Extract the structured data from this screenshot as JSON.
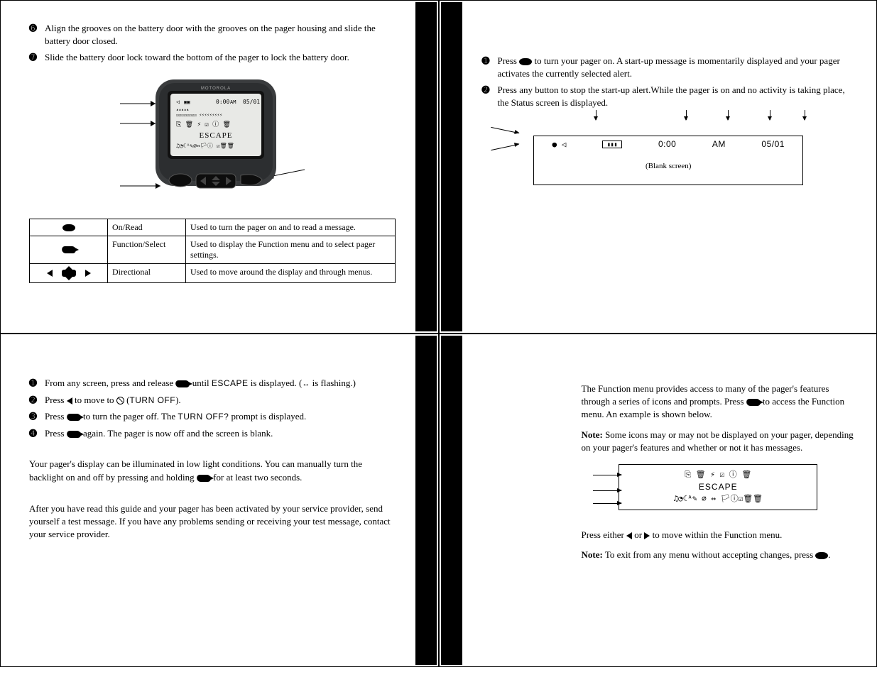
{
  "tl": {
    "steps": [
      {
        "num": "➏",
        "text": "Align the grooves on the battery door with the grooves on the pager housing and slide the battery door closed."
      },
      {
        "num": "➐",
        "text": "Slide the battery door lock toward the bottom of the pager to lock the battery door."
      }
    ],
    "device": {
      "brand": "MOTOROLA",
      "line1_time": "0:00",
      "line1_ampm": "AM",
      "line1_date": "05/01",
      "line3_escape": "ESCAPE"
    },
    "table": {
      "rows": [
        {
          "icon": "oval",
          "name": "On/Read",
          "desc": "Used to turn the pager on and to read a message."
        },
        {
          "icon": "fs",
          "name": "Function/Select",
          "desc": "Used to display the Function menu and to select pager settings."
        },
        {
          "icon": "dir",
          "name": "Directional",
          "desc": "Used to move around the display and through menus."
        }
      ]
    }
  },
  "tr": {
    "steps": [
      {
        "num": "➊",
        "pre": "Press ",
        "post": " to turn your pager on. A start-up message is momentarily displayed and your pager activates the currently selected alert."
      },
      {
        "num": "➋",
        "text": "Press any button to stop the start-up alert.While the pager is on and no activity is taking place, the Status screen is displayed."
      }
    ],
    "status": {
      "time": "0:00",
      "ampm": "AM",
      "date": "05/01",
      "blank": "(Blank screen)"
    }
  },
  "bl": {
    "steps": [
      {
        "num": "➊",
        "pre": "From any screen, press and release ",
        "mid": " until ",
        "word1": "ESCAPE",
        "post1": " is displayed. (",
        "post2": " is flashing.)"
      },
      {
        "num": "➋",
        "pre": "Press ",
        "mid": " to move to ",
        "word1": " (",
        "word2": "TURN OFF",
        "post": ")."
      },
      {
        "num": "➌",
        "pre": "Press ",
        "mid": " to turn the pager off. The ",
        "word1": "TURN OFF?",
        "post": " prompt is displayed."
      },
      {
        "num": "➍",
        "pre": "Press ",
        "post": " again. The pager is now off and the screen is blank."
      }
    ],
    "para_backlight": "Your pager's display can be illuminated in low light conditions. You can manually turn the backlight on and off by pressing and holding ",
    "para_backlight_end": " for at least two seconds.",
    "para_test": "After you have read this guide and your pager has been activated by your service provider, send yourself a test message. If you have any problems sending or receiving your test message, contact your service provider."
  },
  "br": {
    "para1_pre": "The Function menu provides access to many of the pager's features through a series of icons and prompts. Press ",
    "para1_post": " to access the Function menu. An example is shown below.",
    "note_lead": "Note:",
    "note1": " Some icons may or may not be displayed on your pager, depending on your pager's features and whether or not it has messages.",
    "menu": {
      "row1": "⎘  🗑  ⚡  ☑  ⓘ  🗑",
      "escape": "ESCAPE",
      "row3": "♫◔☾ᴬ✎ ⌀ ↔ 🏳ⓘ☑🗑🗑"
    },
    "para2_pre": "Press either ",
    "para2_mid": " or ",
    "para2_post": " to move within the Function menu.",
    "note2": " To exit from any menu without accepting changes, press "
  }
}
